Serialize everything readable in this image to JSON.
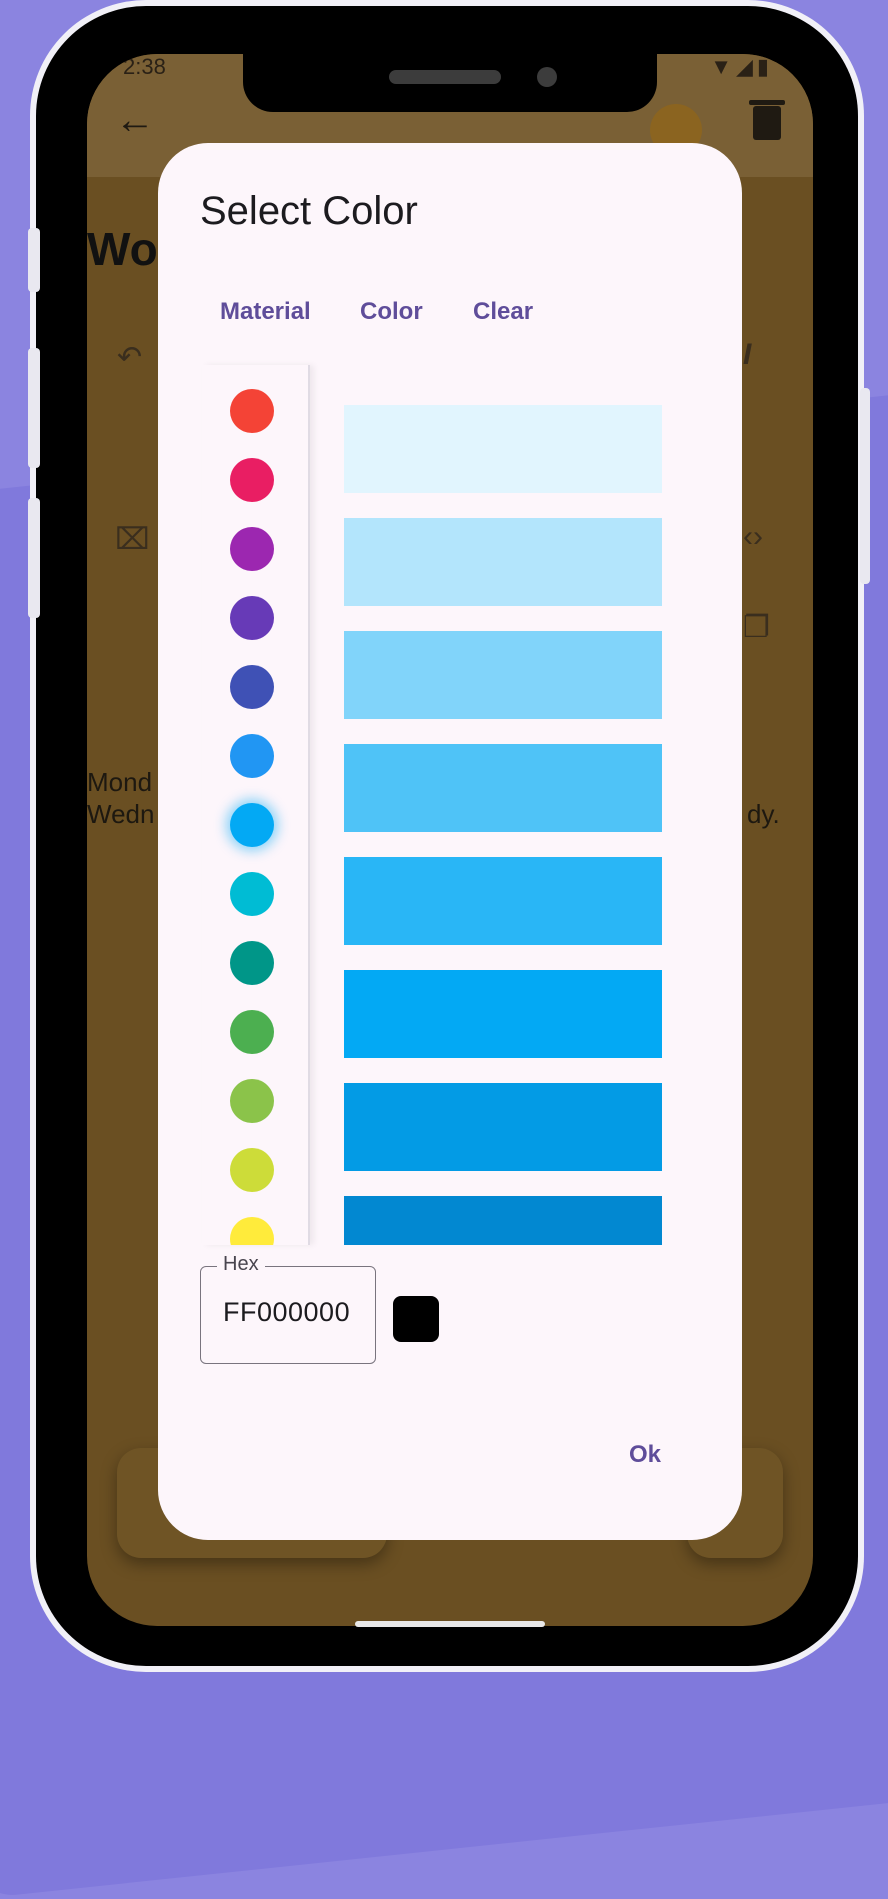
{
  "colors": {
    "background": "#8b84e0",
    "accent": "#5f4d9a",
    "dialog_bg": "#fdf6fb"
  },
  "status_bar": {
    "time": "2:38",
    "icons": [
      "gear-icon",
      "shield-icon",
      "wifi-icon",
      "signal-icon",
      "battery-icon"
    ]
  },
  "app_bar": {
    "back_icon": "arrow-left-icon",
    "delete_icon": "trash-icon"
  },
  "note": {
    "title_partial": "Wo",
    "text_line1": "Mond",
    "text_line2": "Wedn",
    "text_line2_end": "dy."
  },
  "dialog": {
    "title": "Select Color",
    "tabs": [
      {
        "label": "Material"
      },
      {
        "label": "Color"
      },
      {
        "label": "Clear"
      }
    ],
    "swatches": [
      {
        "color": "#f44336"
      },
      {
        "color": "#e91e63"
      },
      {
        "color": "#9c27b0"
      },
      {
        "color": "#673ab7"
      },
      {
        "color": "#3f51b5"
      },
      {
        "color": "#2196f3"
      },
      {
        "color": "#03a9f4",
        "selected": true
      },
      {
        "color": "#00bcd4"
      },
      {
        "color": "#009688"
      },
      {
        "color": "#4caf50"
      },
      {
        "color": "#8bc34a"
      },
      {
        "color": "#cddc39"
      },
      {
        "color": "#ffeb3b"
      }
    ],
    "shades": [
      {
        "color": "#e1f5fe"
      },
      {
        "color": "#b3e5fc"
      },
      {
        "color": "#81d4fa"
      },
      {
        "color": "#4fc3f7"
      },
      {
        "color": "#29b6f6"
      },
      {
        "color": "#03a9f4"
      },
      {
        "color": "#039be5"
      },
      {
        "color": "#0288d1"
      }
    ],
    "hex_label": "Hex",
    "hex_value": "FF000000",
    "preview_color": "#000000",
    "ok_label": "Ok"
  }
}
